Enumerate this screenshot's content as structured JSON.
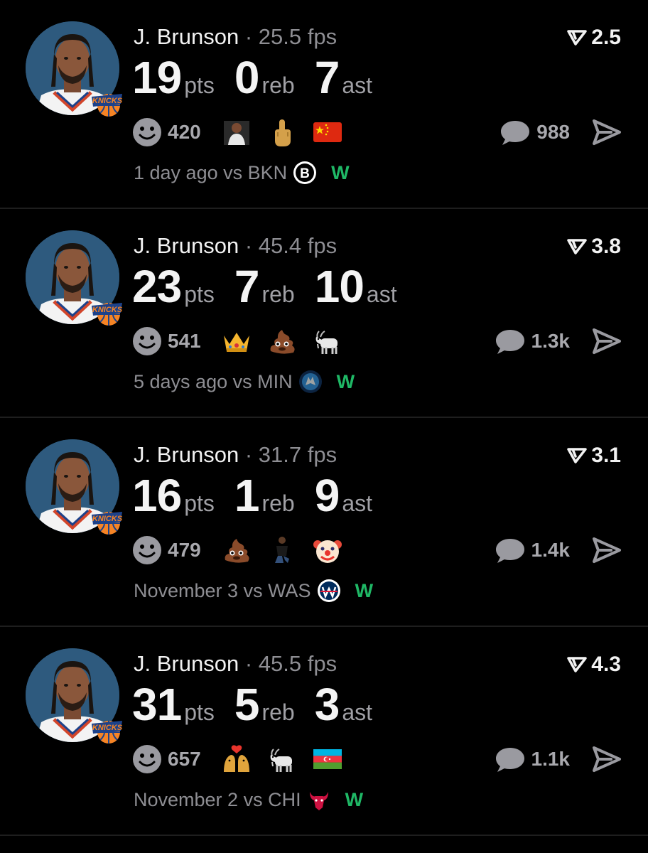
{
  "colors": {
    "background": "#000000",
    "win": "#1fb866",
    "muted": "#8e8e93",
    "divider": "#1e1e1e"
  },
  "cards": [
    {
      "player": "J. Brunson",
      "fps": "· 25.5 fps",
      "rating": "2.5",
      "stats": [
        {
          "value": "19",
          "unit": "pts"
        },
        {
          "value": "0",
          "unit": "reb"
        },
        {
          "value": "7",
          "unit": "ast"
        }
      ],
      "reactions_count": "420",
      "reaction_icons": [
        "player-photo-icon",
        "middle-finger-icon",
        "china-flag-icon"
      ],
      "comments_count": "988",
      "meta": "1 day ago vs BKN",
      "team_logo": "nets-logo-icon",
      "result": "W"
    },
    {
      "player": "J. Brunson",
      "fps": "· 45.4 fps",
      "rating": "3.8",
      "stats": [
        {
          "value": "23",
          "unit": "pts"
        },
        {
          "value": "7",
          "unit": "reb"
        },
        {
          "value": "10",
          "unit": "ast"
        }
      ],
      "reactions_count": "541",
      "reaction_icons": [
        "crown-icon",
        "poop-icon",
        "goat-icon"
      ],
      "comments_count": "1.3k",
      "meta": "5 days ago vs MIN",
      "team_logo": "timberwolves-logo-icon",
      "result": "W"
    },
    {
      "player": "J. Brunson",
      "fps": "· 31.7 fps",
      "rating": "3.1",
      "stats": [
        {
          "value": "16",
          "unit": "pts"
        },
        {
          "value": "1",
          "unit": "reb"
        },
        {
          "value": "9",
          "unit": "ast"
        }
      ],
      "reactions_count": "479",
      "reaction_icons": [
        "poop-icon",
        "kneeling-figure-icon",
        "clown-icon"
      ],
      "comments_count": "1.4k",
      "meta": "November 3 vs WAS",
      "team_logo": "wizards-logo-icon",
      "result": "W"
    },
    {
      "player": "J. Brunson",
      "fps": "· 45.5 fps",
      "rating": "4.3",
      "stats": [
        {
          "value": "31",
          "unit": "pts"
        },
        {
          "value": "5",
          "unit": "reb"
        },
        {
          "value": "3",
          "unit": "ast"
        }
      ],
      "reactions_count": "657",
      "reaction_icons": [
        "kiss-icon",
        "goat-icon",
        "azerbaijan-flag-icon"
      ],
      "comments_count": "1.1k",
      "meta": "November 2 vs CHI",
      "team_logo": "bulls-logo-icon",
      "result": "W"
    }
  ]
}
